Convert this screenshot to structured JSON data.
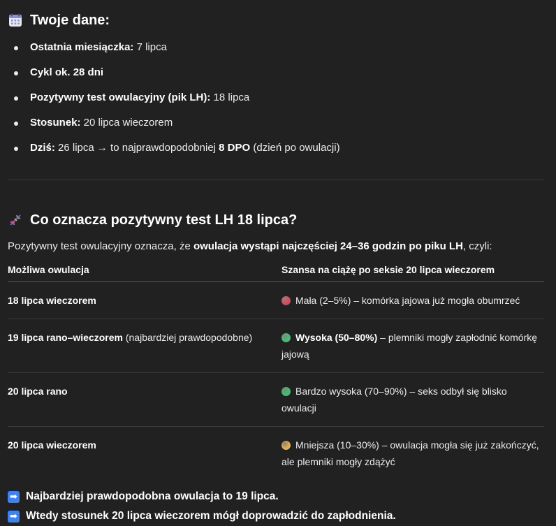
{
  "section1": {
    "title": "Twoje dane:",
    "icon": "calendar-icon",
    "items": [
      {
        "label": "Ostatnia miesiączka:",
        "value": " 7 lipca"
      },
      {
        "label": "Cykl ok. 28 dni",
        "value": ""
      },
      {
        "label": "Pozytywny test owulacyjny (pik LH):",
        "value": " 18 lipca"
      },
      {
        "label": "Stosunek:",
        "value": " 20 lipca wieczorem"
      },
      {
        "label": "Dziś:",
        "value": " 26 lipca → to najprawdopodobniej ",
        "bold2": "8 DPO",
        "value2": " (dzień po owulacji)"
      }
    ]
  },
  "section2": {
    "title": "Co oznacza pozytywny test LH 18 lipca?",
    "icon": "dna-icon",
    "intro_pre": "Pozytywny test owulacyjny oznacza, że ",
    "intro_bold": "owulacja wystąpi najczęściej 24–36 godzin po piku LH",
    "intro_post": ", czyli:",
    "table": {
      "headers": [
        "Możliwa owulacja",
        "Szansa na ciążę po seksie 20 lipca wieczorem"
      ],
      "rows": [
        {
          "ovulation": "18 lipca wieczorem",
          "ovulation_note": "",
          "dot_color": "#e0455a",
          "chance_bold": "",
          "chance": "Mała (2–5%) – komórka jajowa już mogła obumrzeć"
        },
        {
          "ovulation": "19 lipca rano–wieczorem",
          "ovulation_note": " (najbardziej prawdopodobne)",
          "dot_color": "#3ec26e",
          "chance_bold": "Wysoka (50–80%)",
          "chance": " – plemniki mogły zapłodnić komórkę jajową"
        },
        {
          "ovulation": "20 lipca rano",
          "ovulation_note": "",
          "dot_color": "#3ec26e",
          "chance_bold": "",
          "chance": "Bardzo wysoka (70–90%) – seks odbył się blisko owulacji"
        },
        {
          "ovulation": "20 lipca wieczorem",
          "ovulation_note": "",
          "dot_color": "#e8b04a",
          "chance_bold": "",
          "chance": "Mniejsza (10–30%) – owulacja mogła się już zakończyć, ale plemniki mogły zdążyć"
        }
      ]
    }
  },
  "footer": {
    "icon": "right-arrow-icon",
    "arrow_glyph": "➡",
    "lines": [
      "Najbardziej prawdopodobna owulacja to 19 lipca.",
      "Wtedy stosunek 20 lipca wieczorem mógł doprowadzić do zapłodnienia."
    ]
  }
}
